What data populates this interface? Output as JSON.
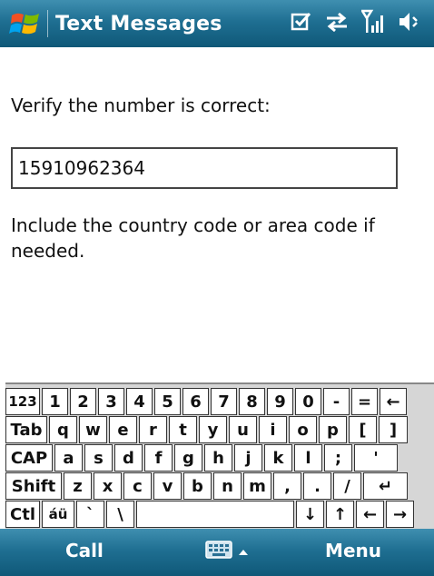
{
  "title_bar": {
    "title": "Text Messages",
    "icons": [
      "windows-start-icon",
      "checkbox-icon",
      "sync-arrows-icon",
      "signal-strength-icon",
      "speaker-volume-icon"
    ]
  },
  "main": {
    "prompt": "Verify the number is correct:",
    "phone_number": "15910962364",
    "hint": "Include the country code or area code if needed."
  },
  "keyboard": {
    "rows": [
      [
        "123",
        "1",
        "2",
        "3",
        "4",
        "5",
        "6",
        "7",
        "8",
        "9",
        "0",
        "-",
        "=",
        "←"
      ],
      [
        "Tab",
        "q",
        "w",
        "e",
        "r",
        "t",
        "y",
        "u",
        "i",
        "o",
        "p",
        "[",
        "]"
      ],
      [
        "CAP",
        "a",
        "s",
        "d",
        "f",
        "g",
        "h",
        "j",
        "k",
        "l",
        ";",
        "'"
      ],
      [
        "Shift",
        "z",
        "x",
        "c",
        "v",
        "b",
        "n",
        "m",
        ",",
        ".",
        "/",
        "↵"
      ],
      [
        "Ctl",
        "áü",
        "`",
        "\\",
        "",
        "↓",
        "↑",
        "←",
        "→"
      ]
    ]
  },
  "softkeys": {
    "left": "Call",
    "right": "Menu"
  },
  "colors": {
    "bar_top": "#3f8fb0",
    "bar_bottom": "#0f5878"
  }
}
